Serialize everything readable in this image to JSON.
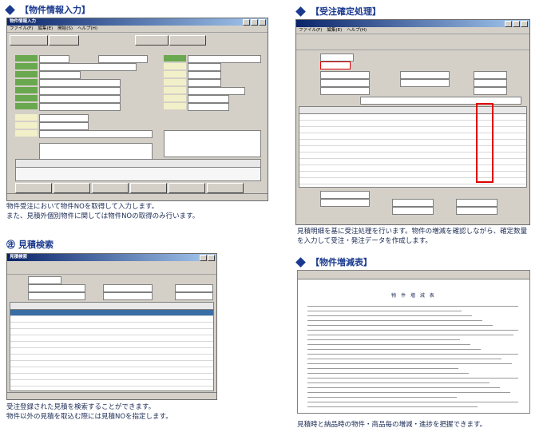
{
  "panels": {
    "p1": {
      "title": "【物件情報入力】",
      "caption1": "物件受注において物件NOを取得して入力します。",
      "caption2": "また、見積外個別物件に関しては物件NOの取得のみ行います。",
      "window_title": "物件情報入力",
      "menu": [
        "ファイル(F)",
        "編集(E)",
        "開始(S)",
        "ヘルプ(H)"
      ]
    },
    "p2": {
      "title": "【受注確定処理】",
      "caption1": "見積明細を基に受注処理を行います。物件の増減を確認しながら、確定数量",
      "caption2": "を入力して受注・発注データを作成します。",
      "menu": [
        "ファイル(F)",
        "編集(E)",
        "ヘルプ(H)"
      ]
    },
    "p3": {
      "badge": "㊟",
      "title": "見積検索",
      "caption1": "受注登録された見積を検索することができます。",
      "caption2": "物件以外の見積を取込む際には見積NOを指定します。",
      "window_title": "見積検索"
    },
    "p4": {
      "title": "【物件増減表】",
      "caption1": "見積時と納品時の物件・商品毎の増減・進捗を把握できます。",
      "doc_title": "物 件 増 減 表"
    }
  },
  "colors": {
    "accent": "#1b3a8f",
    "highlight": "#e00000",
    "label_green": "#6aa84f"
  }
}
